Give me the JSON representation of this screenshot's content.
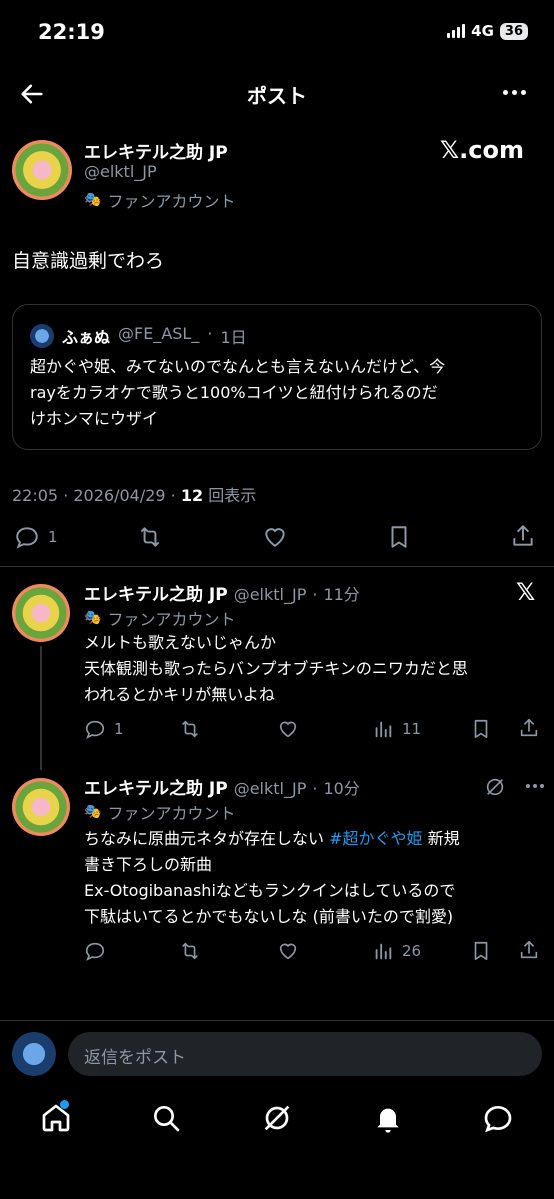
{
  "status_bar": {
    "time": "22:19",
    "network": "4G",
    "battery": "36"
  },
  "header": {
    "title": "ポスト"
  },
  "main_post": {
    "display_name": "エレキテル之助 JP",
    "handle": "@elktl_JP",
    "label": "ファンアカウント",
    "badge": "𝕏.com",
    "text": "自意識過剰でわろ",
    "quote": {
      "display_name": "ふぁぬ",
      "handle": "@FE_ASL_",
      "time": "1日",
      "lines": [
        "超かぐや姫、みてないのでなんとも言えないんだけど、今",
        "rayをカラオケで歌うと100%コイツと紐付けられるのだ",
        "けホンマにウザイ"
      ]
    },
    "timestamp": "22:05 · 2026/04/29 · ",
    "views_count": "12",
    "views_label": " 回表示",
    "actions": {
      "reply_count": "1"
    }
  },
  "replies": [
    {
      "display_name": "エレキテル之助 JP",
      "handle": "@elktl_JP",
      "time": "11分",
      "label": "ファンアカウント",
      "lines": [
        "メルトも歌えないじゃんか",
        "天体観測も歌ったらバンプオブチキンのニワカだと思",
        "われるとかキリが無いよね"
      ],
      "reply_count": "1",
      "views": "11"
    },
    {
      "display_name": "エレキテル之助 JP",
      "handle": "@elktl_JP",
      "time": "10分",
      "label": "ファンアカウント",
      "line1_prefix": "ちなみに原曲元ネタが存在しない ",
      "hashtag": "#超かぐや姫",
      "line1_suffix": " 新規",
      "lines": [
        "書き下ろしの新曲",
        "Ex-Otogibanashiなどもランクインはしているので",
        "下駄はいてるとかでもないしな (前書いたので割愛)"
      ],
      "views": "26"
    }
  ],
  "composer": {
    "placeholder": "返信をポスト"
  },
  "colors": {
    "accent": "#1d9bf0",
    "background": "#000000",
    "secondary_text": "#8b98a5"
  },
  "icons": {
    "header": [
      "back-arrow-icon",
      "more-icon"
    ],
    "actions": [
      "reply-icon",
      "repost-icon",
      "like-icon",
      "bookmark-icon",
      "share-icon",
      "views-icon"
    ],
    "tabs": [
      "home-icon",
      "search-icon",
      "grok-icon",
      "notifications-icon",
      "messages-icon"
    ]
  }
}
